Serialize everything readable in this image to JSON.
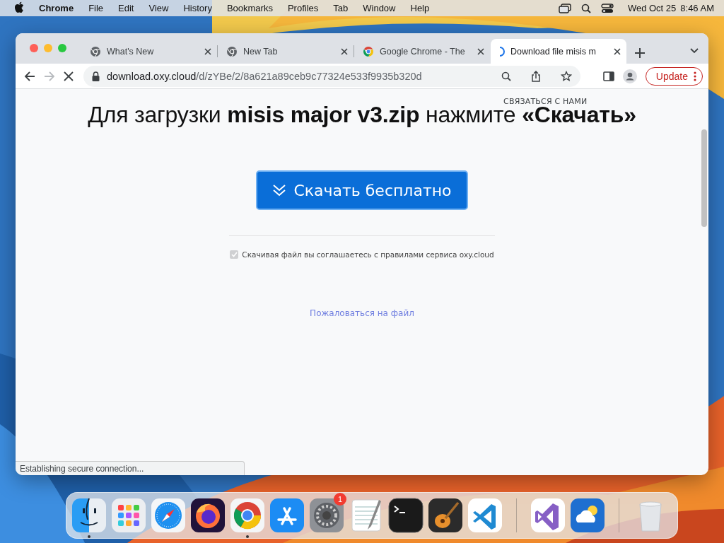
{
  "menu_bar": {
    "app": "Chrome",
    "items": [
      "File",
      "Edit",
      "View",
      "History",
      "Bookmarks",
      "Profiles",
      "Tab",
      "Window",
      "Help"
    ],
    "date": "Wed Oct 25",
    "time": "8:46 AM"
  },
  "tabs": [
    {
      "title": "What's New",
      "kind": "chrome",
      "selected": false
    },
    {
      "title": "New Tab",
      "kind": "chrome",
      "selected": false
    },
    {
      "title": "Google Chrome - The",
      "kind": "google",
      "selected": false
    },
    {
      "title": "Download file misis m",
      "kind": "loading",
      "selected": true
    }
  ],
  "toolbar": {
    "host": "download.oxy.cloud",
    "path": "/d/zYBe/2/8a621a89ceb9c77324e533f9935b320d",
    "loading": true,
    "update_button": "Update"
  },
  "page": {
    "heading": "Для загрузки **misis major v3.zip** нажмите **«Скачать»**",
    "contact_link": "СВЯЗАТЬСЯ С НАМИ",
    "download_button": "Скачать бесплатно",
    "agreement": {
      "text": "Скачивая файл вы соглашаетесь с правилами сервиса oxy.cloud",
      "checked": true,
      "disabled": true
    },
    "report_link": "Пожаловаться на файл"
  },
  "status_bubble": "Establishing secure connection...",
  "dock": [
    {
      "kind": "finder",
      "running": true
    },
    {
      "kind": "launchpad",
      "running": false
    },
    {
      "kind": "safari",
      "running": false
    },
    {
      "kind": "firefox",
      "running": false
    },
    {
      "kind": "chrome",
      "running": true
    },
    {
      "kind": "appstore",
      "running": false
    },
    {
      "kind": "settings",
      "running": false,
      "badge": "1"
    },
    {
      "kind": "textedit",
      "running": false
    },
    {
      "kind": "terminal",
      "running": false
    },
    {
      "kind": "garageband",
      "running": false
    },
    {
      "kind": "vscode",
      "running": false
    },
    {
      "kind": "divider"
    },
    {
      "kind": "vstudio",
      "running": false
    },
    {
      "kind": "weather",
      "running": false
    },
    {
      "kind": "divider"
    },
    {
      "kind": "trash",
      "running": false
    }
  ]
}
